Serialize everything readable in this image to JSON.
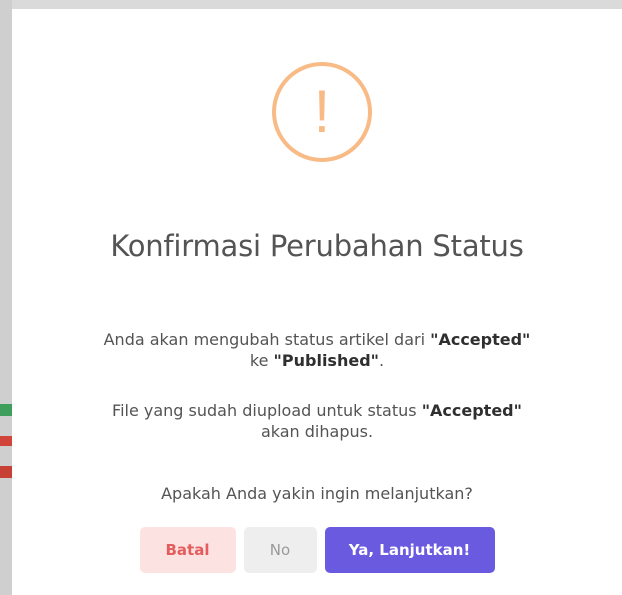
{
  "dialog": {
    "icon": "warning-exclamation-icon",
    "icon_glyph": "!",
    "accent_color": "#f8bb86",
    "title": "Konfirmasi Perubahan Status",
    "paragraph1": {
      "prefix": "Anda akan mengubah status artikel dari ",
      "from_status": "\"Accepted\"",
      "middle": "ke ",
      "to_status": "\"Published\"",
      "suffix": "."
    },
    "paragraph2": {
      "prefix": "File yang sudah diupload untuk status ",
      "status": "\"Accepted\"",
      "suffix": "akan dihapus."
    },
    "question": "Apakah Anda yakin ingin melanjutkan?",
    "buttons": {
      "cancel_label": "Batal",
      "deny_label": "No",
      "confirm_label": "Ya, Lanjutkan!"
    },
    "colors": {
      "confirm": "#6a5ae0",
      "cancel_bg": "#fde2e2",
      "cancel_text": "#e35d5d"
    }
  }
}
